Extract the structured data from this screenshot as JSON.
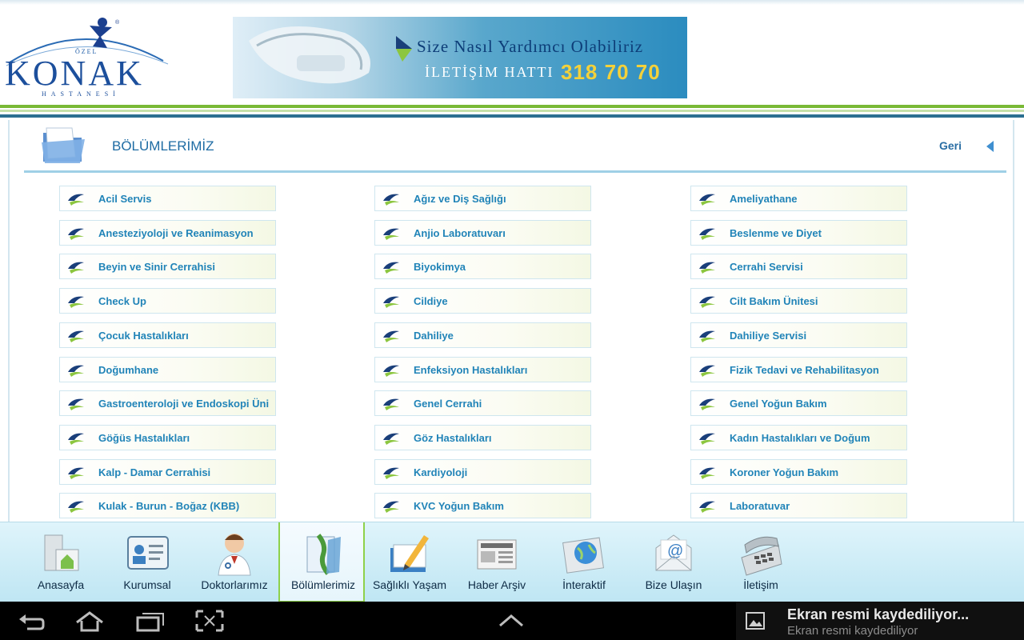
{
  "header": {
    "logo": {
      "top_text": "ÖZEL",
      "name": "KONAK",
      "bottom_text": "HASTANESİ"
    },
    "banner": {
      "line1": "Size Nasıl Yardımcı Olabiliriz",
      "line2": "İLETİŞİM HATTI",
      "phone": "318 70 70"
    }
  },
  "page": {
    "title": "BÖLÜMLERİMİZ",
    "back_label": "Geri"
  },
  "departments": [
    "Acil Servis",
    "Ağız ve Diş Sağlığı",
    "Ameliyathane",
    "Anesteziyoloji ve Reanimasyon",
    "Anjio Laboratuvarı",
    "Beslenme ve Diyet",
    "Beyin ve Sinir Cerrahisi",
    "Biyokimya",
    "Cerrahi Servisi",
    "Check Up",
    "Cildiye",
    "Cilt Bakım Ünitesi",
    "Çocuk Hastalıkları",
    "Dahiliye",
    "Dahiliye Servisi",
    "Doğumhane",
    "Enfeksiyon Hastalıkları",
    "Fizik Tedavi ve Rehabilitasyon",
    "Gastroenteroloji ve Endoskopi Üni",
    "Genel Cerrahi",
    "Genel Yoğun Bakım",
    "Göğüs Hastalıkları",
    "Göz Hastalıkları",
    "Kadın Hastalıkları ve Doğum",
    "Kalp - Damar Cerrahisi",
    "Kardiyoloji",
    "Koroner Yoğun Bakım",
    "Kulak - Burun - Boğaz (KBB)",
    "KVC Yoğun Bakım",
    "Laboratuvar"
  ],
  "bottom_nav": [
    {
      "label": "Anasayfa",
      "icon": "home-building-icon"
    },
    {
      "label": "Kurumsal",
      "icon": "id-card-icon"
    },
    {
      "label": "Doktorlarımız",
      "icon": "doctor-icon"
    },
    {
      "label": "Bölümlerimiz",
      "icon": "folder-icon",
      "active": true
    },
    {
      "label": "Sağlıklı Yaşam",
      "icon": "notebook-pen-icon"
    },
    {
      "label": "Haber Arşiv",
      "icon": "newspaper-icon"
    },
    {
      "label": "İnteraktif",
      "icon": "globe-icon"
    },
    {
      "label": "Bize Ulaşın",
      "icon": "email-icon"
    },
    {
      "label": "İletişim",
      "icon": "telephone-icon"
    }
  ],
  "notification": {
    "title": "Ekran resmi kaydediliyor...",
    "subtitle": "Ekran resmi kaydediliyor"
  },
  "colors": {
    "accent_blue": "#2184b8",
    "accent_green": "#79b935",
    "title_blue": "#1d6ba3"
  }
}
